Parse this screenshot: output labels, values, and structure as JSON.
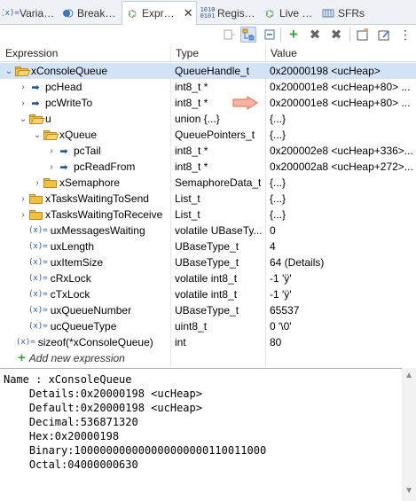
{
  "tabs": [
    {
      "label": "Varia…",
      "icon": "variables-icon"
    },
    {
      "label": "Break…",
      "icon": "breakpoints-icon"
    },
    {
      "label": "Expr…",
      "icon": "expressions-icon",
      "close": "✕"
    },
    {
      "label": "Regis…",
      "icon": "registers-icon"
    },
    {
      "label": "Live …",
      "icon": "live-expressions-icon"
    },
    {
      "label": "SFRs",
      "icon": "sfrs-icon"
    }
  ],
  "columns": {
    "expression": "Expression",
    "type": "Type",
    "value": "Value"
  },
  "rows": [
    {
      "expr": "xConsoleQueue",
      "type": "QueueHandle_t",
      "value": "0x20000198 <ucHeap>"
    },
    {
      "expr": "pcHead",
      "type": "int8_t *",
      "value": "0x200001e8 <ucHeap+80> ..."
    },
    {
      "expr": "pcWriteTo",
      "type": "int8_t *",
      "value": "0x200001e8 <ucHeap+80> ..."
    },
    {
      "expr": "u",
      "type": "union {...}",
      "value": "{...}"
    },
    {
      "expr": "xQueue",
      "type": "QueuePointers_t",
      "value": "{...}"
    },
    {
      "expr": "pcTail",
      "type": "int8_t *",
      "value": "0x200002e8 <ucHeap+336>..."
    },
    {
      "expr": "pcReadFrom",
      "type": "int8_t *",
      "value": "0x200002a8 <ucHeap+272>..."
    },
    {
      "expr": "xSemaphore",
      "type": "SemaphoreData_t",
      "value": "{...}"
    },
    {
      "expr": "xTasksWaitingToSend",
      "type": "List_t",
      "value": "{...}"
    },
    {
      "expr": "xTasksWaitingToReceive",
      "type": "List_t",
      "value": "{...}"
    },
    {
      "expr": "uxMessagesWaiting",
      "type": "volatile UBaseTy...",
      "value": "0"
    },
    {
      "expr": "uxLength",
      "type": "UBaseType_t",
      "value": "4"
    },
    {
      "expr": "uxItemSize",
      "type": "UBaseType_t",
      "value": "64 (Details)"
    },
    {
      "expr": "cRxLock",
      "type": "volatile int8_t",
      "value": "-1 'ÿ'"
    },
    {
      "expr": "cTxLock",
      "type": "volatile int8_t",
      "value": "-1 'ÿ'"
    },
    {
      "expr": "uxQueueNumber",
      "type": "UBaseType_t",
      "value": "65537"
    },
    {
      "expr": "ucQueueType",
      "type": "uint8_t",
      "value": "0 '\\0'"
    },
    {
      "expr": "sizeof(*xConsoleQueue)",
      "type": "int",
      "value": "80"
    }
  ],
  "var_icon_text": "(x)=",
  "add_new": "Add new expression",
  "details": [
    "Name : xConsoleQueue",
    "    Details:0x20000198 <ucHeap>",
    "    Default:0x20000198 <ucHeap>",
    "    Decimal:536871320",
    "    Hex:0x20000198",
    "    Binary:100000000000000000000110011000",
    "    Octal:04000000630"
  ],
  "colors": {
    "selected_row": "#d4e3f7",
    "folder": "#f0c045",
    "add_icon": "#3aa534",
    "hint_arrow": "#f4a08a"
  }
}
